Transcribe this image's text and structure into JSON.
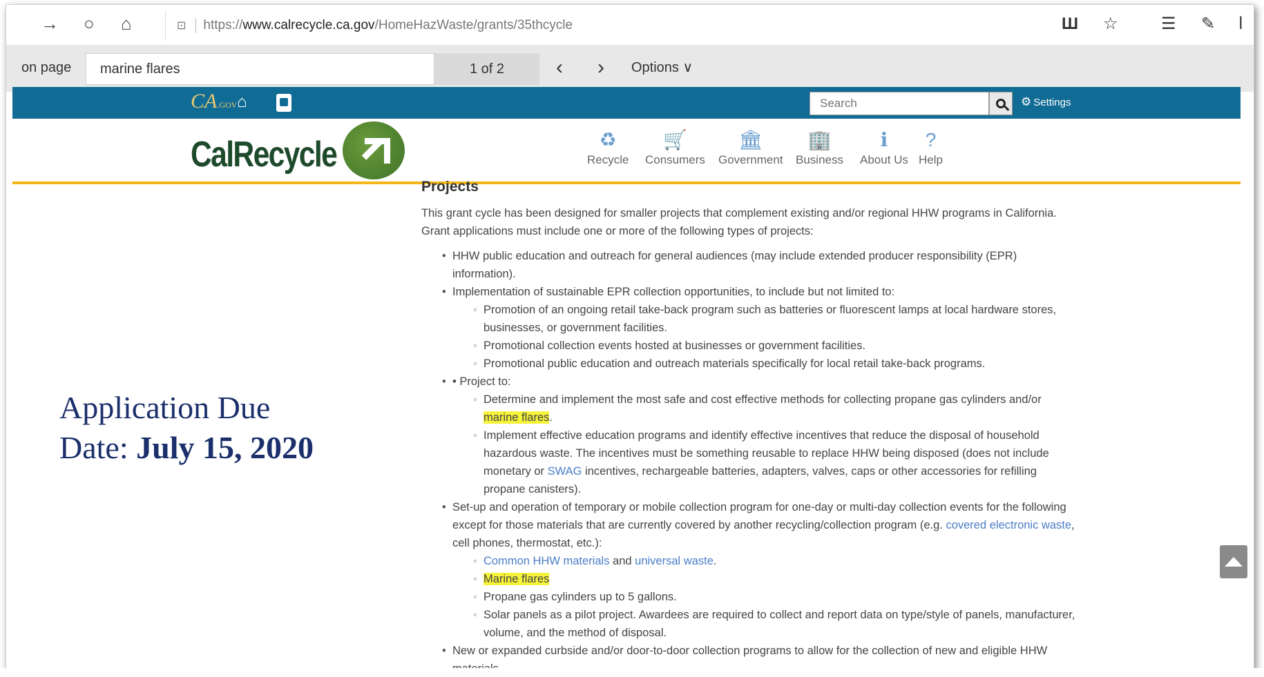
{
  "browser": {
    "url_prefix": "https://",
    "url_domain": "www.calrecycle.ca.gov",
    "url_path": "/HomeHazWaste/grants/35thcycle",
    "nav_back": "→",
    "nav_refresh": "○",
    "nav_home": "⌂",
    "tab_icon": "⊡",
    "tools": {
      "reading_view": "📖",
      "favorite": "☆",
      "favorites_list": "✰",
      "notes": "✎",
      "share": "⇱"
    }
  },
  "findbar": {
    "label": "on page",
    "query": "marine flares",
    "count": "1 of 2",
    "prev": "‹",
    "next": "›",
    "options": "Options ∨"
  },
  "cabar": {
    "ca_logo": "CA",
    "ca_logo_sub": ".GOV",
    "home_icon": "⌂",
    "search_placeholder": "Search",
    "settings_label": "Settings"
  },
  "header": {
    "brand_part1": "Cal",
    "brand_part2": "Recycle",
    "nav": [
      {
        "label": "Recycle",
        "icon": "♻"
      },
      {
        "label": "Consumers",
        "icon": "🛒"
      },
      {
        "label": "Government",
        "icon": "🏛"
      },
      {
        "label": "Business",
        "icon": "🏢"
      },
      {
        "label": "About Us",
        "icon": "ℹ"
      },
      {
        "label": "Help",
        "icon": "?"
      }
    ]
  },
  "content": {
    "section_title": "Projects",
    "intro": "This grant cycle has been designed for smaller projects that complement existing and/or regional HHW programs in California. Grant applications must include one or more of the following types of projects:",
    "b1": "HHW public education and outreach for general audiences (may include extended producer responsibility (EPR) information).",
    "b2": "Implementation of sustainable EPR collection opportunities, to include but not limited to:",
    "b2_1": "Promotion of an ongoing retail take-back program such as batteries or fluorescent lamps at local hardware stores, businesses, or government facilities.",
    "b2_2": "Promotional collection events hosted at businesses or government facilities.",
    "b2_3": "Promotional public education and outreach materials specifically for local retail take-back programs.",
    "b3": "• Project to:",
    "b3_1_a": "Determine and implement the most safe and cost effective methods for collecting propane gas cylinders and/or ",
    "b3_1_hl": "marine flares",
    "b3_1_b": ".",
    "b3_2_a": "Implement effective education programs and identify effective incentives that reduce the disposal of household hazardous waste. The incentives must be something reusable to replace HHW being disposed (does not include monetary or ",
    "b3_2_link": "SWAG",
    "b3_2_b": " incentives, rechargeable batteries, adapters, valves, caps or other accessories for refilling propane canisters).",
    "b4_a": "Set-up and operation of temporary or mobile collection program for one-day or multi-day collection events for the following except for those materials that are currently covered by another recycling/collection program (e.g. ",
    "b4_link": "covered electronic waste",
    "b4_b": ", cell phones, thermostat, etc.):",
    "b4_1_link1": "Common HHW materials",
    "b4_1_mid": " and ",
    "b4_1_link2": "universal waste",
    "b4_1_end": ".",
    "b4_2_hl": "Marine flares",
    "b4_3": "Propane gas cylinders up to 5 gallons.",
    "b4_4": "Solar panels as a pilot project. Awardees are required to collect and report data on type/style of panels, manufacturer, volume, and the method of disposal.",
    "b5": "New or expanded curbside and/or door-to-door collection programs to allow for the collection of new and eligible HHW materials."
  },
  "overlay": {
    "line1": "Application Due",
    "line2_prefix": "Date: ",
    "line2_date": "July 15, 2020"
  },
  "colors": {
    "ca_blue": "#106c95",
    "accent_gold": "#f3b517",
    "highlight": "#f6f33b",
    "link": "#4a7dc8",
    "due_text": "#1b2f6b"
  }
}
